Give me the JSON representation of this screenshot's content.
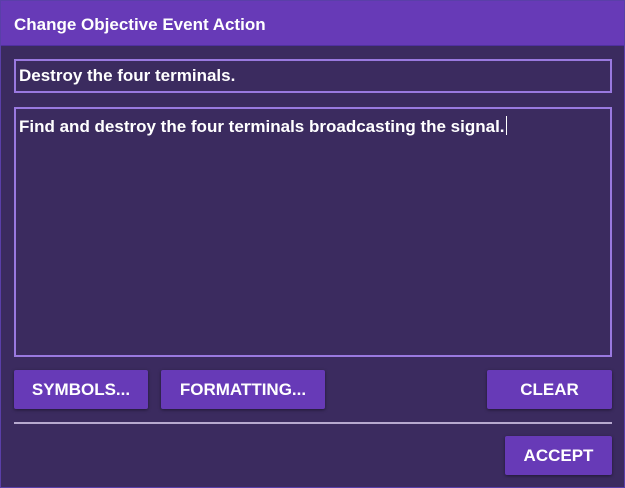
{
  "dialog": {
    "title": "Change Objective Event Action"
  },
  "fields": {
    "objective_title": "Destroy the four terminals.",
    "objective_description": "Find and destroy the four terminals broadcasting the signal."
  },
  "buttons": {
    "symbols": "SYMBOLS...",
    "formatting": "FORMATTING...",
    "clear": "CLEAR",
    "accept": "ACCEPT"
  },
  "colors": {
    "accent": "#673ab7",
    "background": "#3b2b5f",
    "field_border": "#9a79e0",
    "text": "#ffffff"
  }
}
